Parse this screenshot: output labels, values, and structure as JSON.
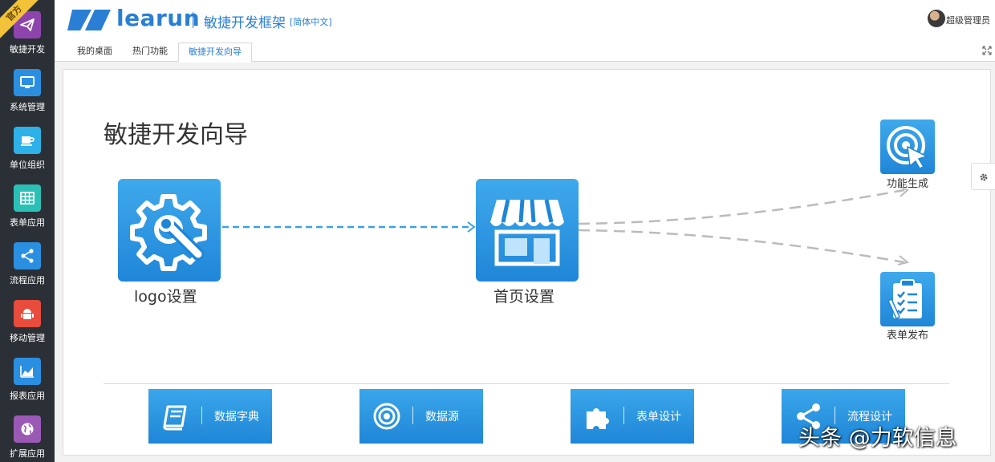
{
  "sidebar": {
    "ribbon": "官方",
    "items": [
      {
        "label": "敏捷开发",
        "icon": "paper-plane-icon",
        "color": "#8e44ad"
      },
      {
        "label": "系统管理",
        "icon": "monitor-icon",
        "color": "#2a8fe0"
      },
      {
        "label": "单位组织",
        "icon": "coffee-cup-icon",
        "color": "#2eb0e8"
      },
      {
        "label": "表单应用",
        "icon": "table-grid-icon",
        "color": "#2bc0b6"
      },
      {
        "label": "流程应用",
        "icon": "share-nodes-icon",
        "color": "#2a8fe0"
      },
      {
        "label": "移动管理",
        "icon": "android-icon",
        "color": "#e74c3c"
      },
      {
        "label": "报表应用",
        "icon": "area-chart-icon",
        "color": "#2a8fe0"
      },
      {
        "label": "扩展应用",
        "icon": "globe-icon",
        "color": "#9b59b6"
      }
    ]
  },
  "header": {
    "logo_text": "learun",
    "framework_title": "敏捷开发框架",
    "language_link": "[简体中文]",
    "user_name": "超级管理员",
    "brand_color": "#2a7fd4"
  },
  "tabs": [
    {
      "label": "我的桌面",
      "active": false
    },
    {
      "label": "热门功能",
      "active": false
    },
    {
      "label": "敏捷开发向导",
      "active": true
    }
  ],
  "guide": {
    "title": "敏捷开发向导",
    "steps": [
      {
        "label": "logo设置",
        "icon": "gear-wrench-icon"
      },
      {
        "label": "首页设置",
        "icon": "storefront-icon"
      }
    ],
    "targets": [
      {
        "label": "功能生成",
        "icon": "target-cursor-icon"
      },
      {
        "label": "表单发布",
        "icon": "clipboard-checklist-icon"
      }
    ]
  },
  "modules": [
    {
      "label": "数据字典",
      "icon": "book-icon"
    },
    {
      "label": "数据源",
      "icon": "target-rings-icon"
    },
    {
      "label": "表单设计",
      "icon": "puzzle-icon"
    },
    {
      "label": "流程设计",
      "icon": "share-nodes-icon"
    }
  ],
  "watermark": "头条 @力软信息"
}
